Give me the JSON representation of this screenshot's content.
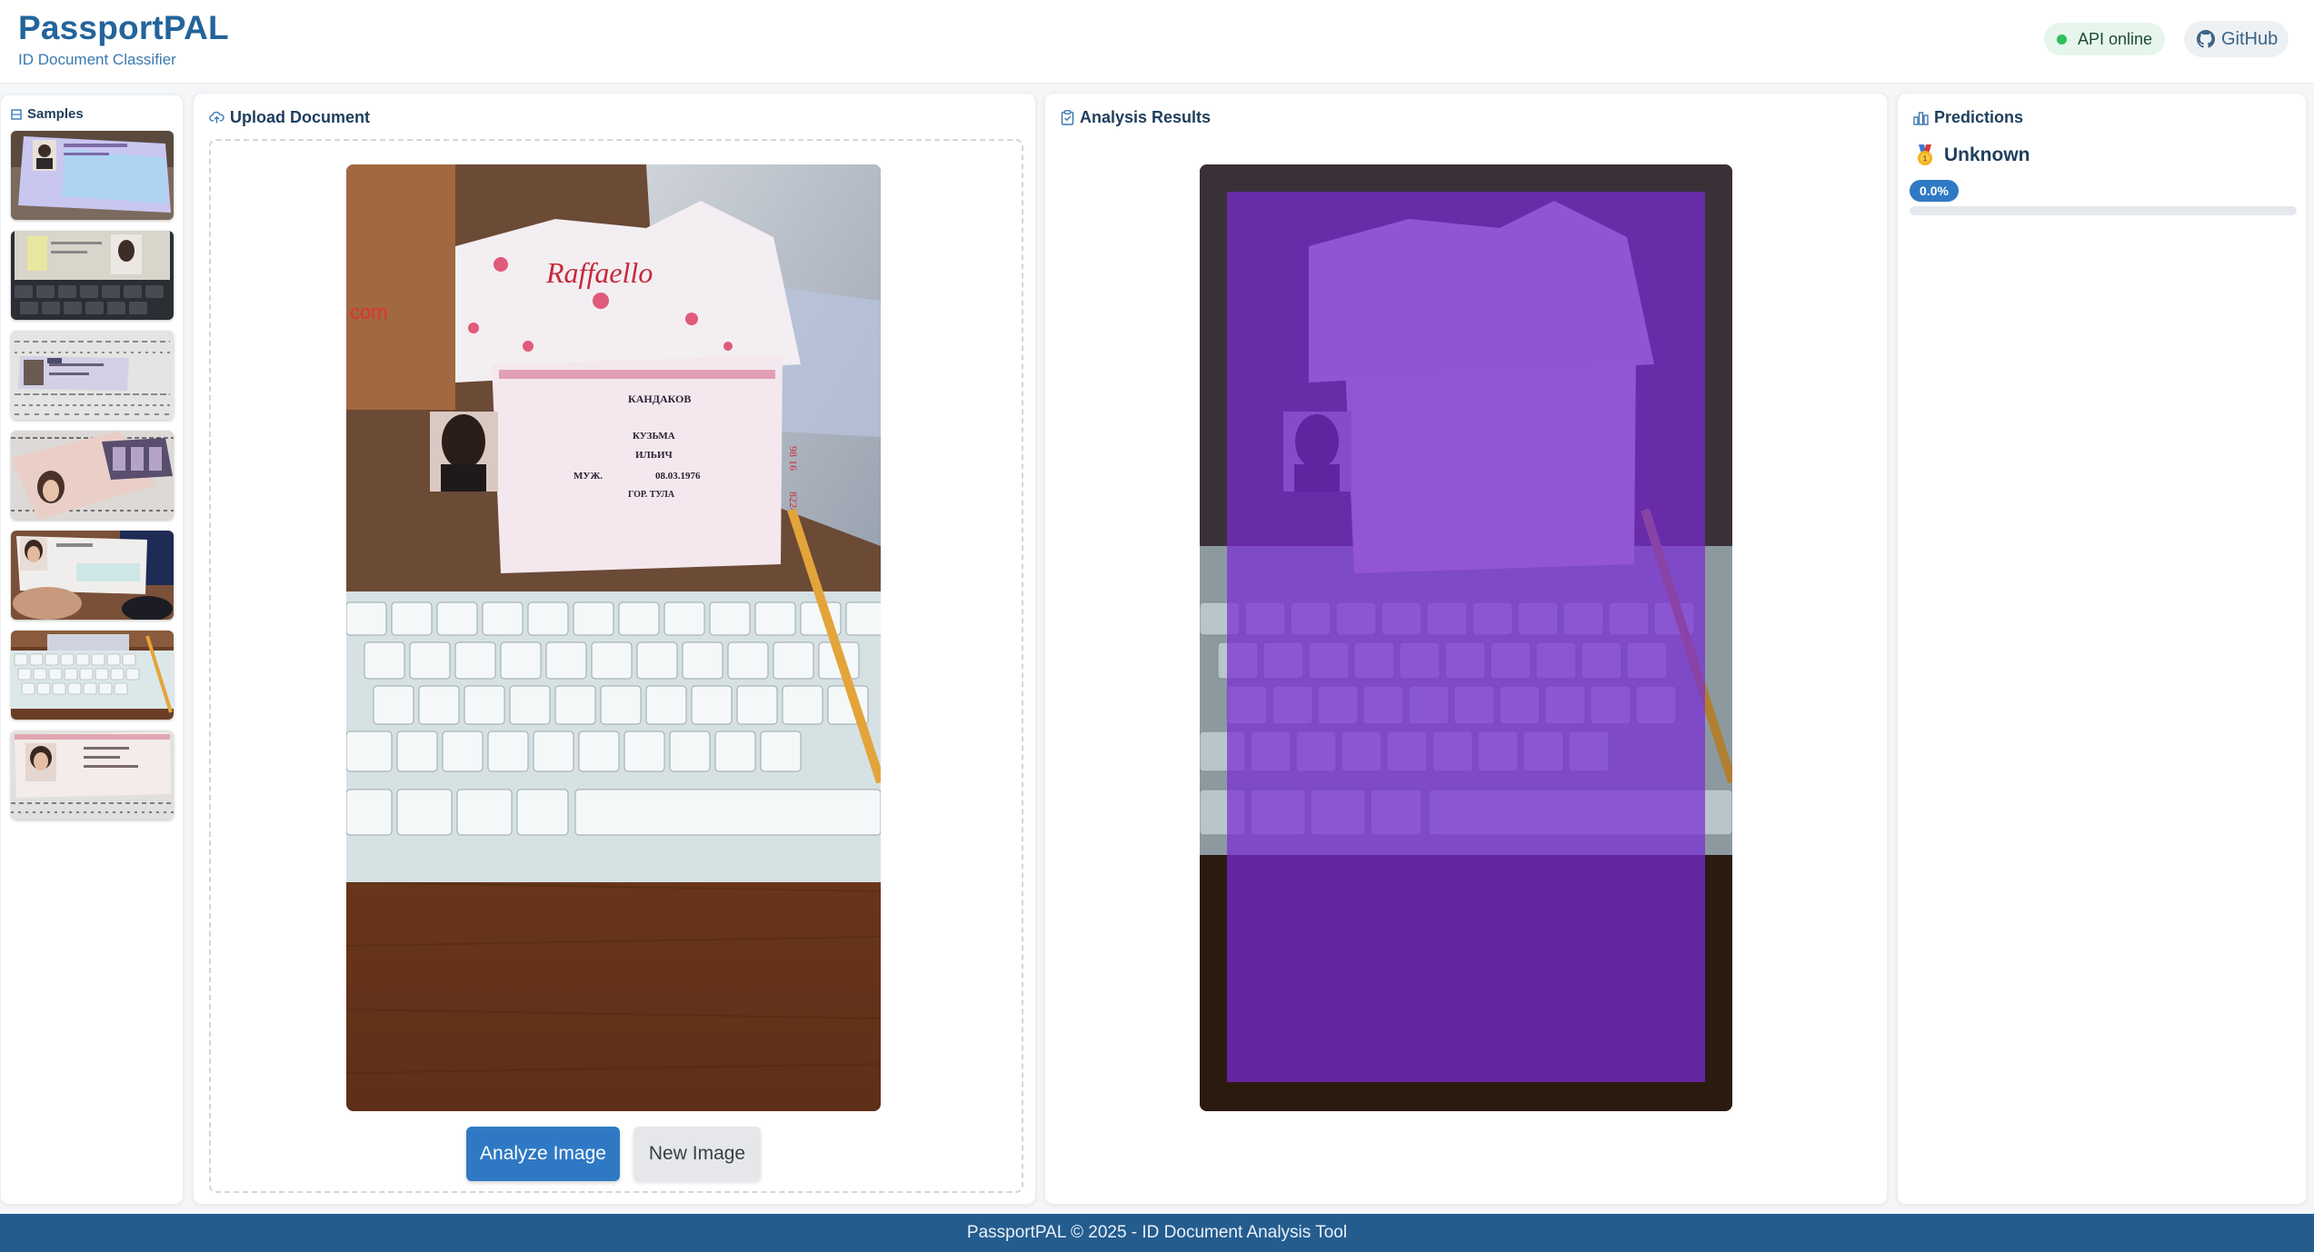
{
  "header": {
    "title": "PassportPAL",
    "subtitle": "ID Document Classifier",
    "api_status": "API online",
    "github_label": "GitHub"
  },
  "samples": {
    "title": "Samples",
    "items": [
      "sample-1",
      "sample-2",
      "sample-3",
      "sample-4",
      "sample-5",
      "sample-6",
      "sample-7"
    ]
  },
  "upload": {
    "title": "Upload Document",
    "analyze_label": "Analyze Image",
    "new_label": "New Image",
    "document": {
      "brand": "Raffaello",
      "surname": "КАНДАКОВ",
      "name": "КУЗЬМА",
      "patronymic": "ИЛЬИЧ",
      "sex": "МУЖ.",
      "birth_date": "08.03.1976",
      "birth_place": "ГОР. ТУЛА",
      "series": "98 16",
      "number": "822479"
    }
  },
  "results": {
    "title": "Analysis Results",
    "overlay_color": "#7a2bd6"
  },
  "predictions": {
    "title": "Predictions",
    "label": "Unknown",
    "percent": "0.0%",
    "confidence": 0.0
  },
  "footer": {
    "text": "PassportPAL © 2025 - ID Document Analysis Tool"
  },
  "colors": {
    "primary": "#2f79c4",
    "brand": "#23649b",
    "footer": "#245c8e",
    "online": "#2fbf5f"
  }
}
